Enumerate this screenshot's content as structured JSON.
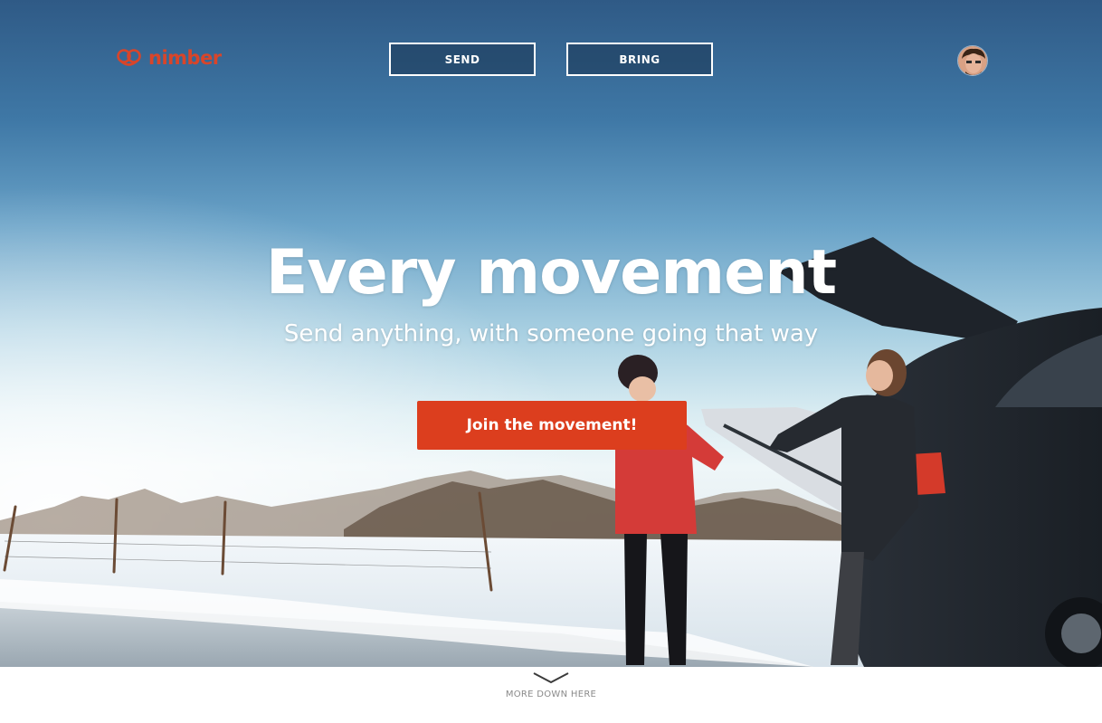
{
  "header": {
    "logo_text": "nimber",
    "nav": {
      "send_label": "SEND",
      "bring_label": "BRING"
    },
    "avatar_icon": "user-avatar"
  },
  "hero": {
    "headline": "Every movement",
    "subline": "Send anything, with someone going that way",
    "cta_label": "Join the movement!"
  },
  "footer_hint": {
    "label": "MORE DOWN HERE",
    "icon": "chevron-down-icon"
  },
  "colors": {
    "brand": "#d8452a",
    "cta": "#dc3e1e",
    "nav_bg": "#1a3452"
  }
}
